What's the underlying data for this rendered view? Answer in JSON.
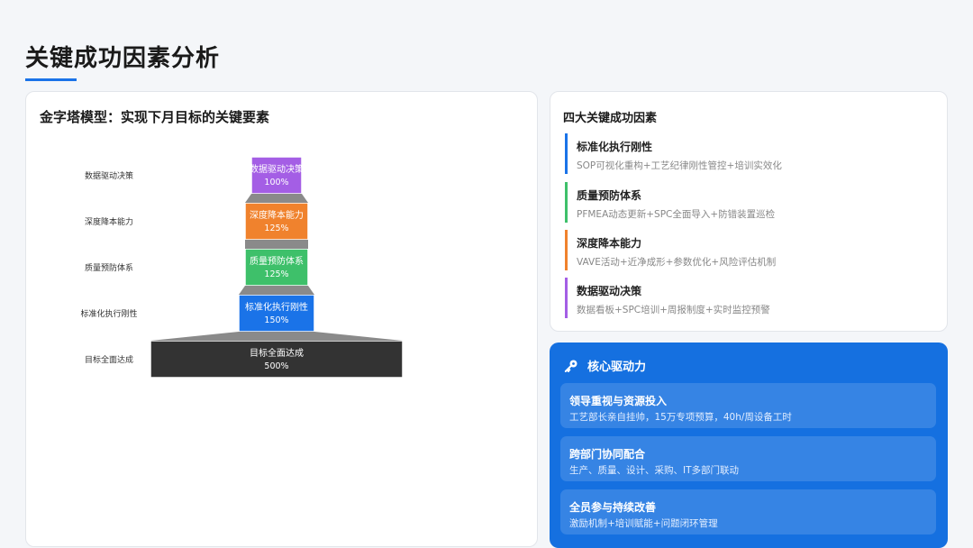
{
  "page": {
    "title": "关键成功因素分析"
  },
  "left_card": {
    "title": "金字塔模型：实现下月目标的关键要素"
  },
  "chart_data": {
    "type": "bar",
    "title": "金字塔模型：实现下月目标的关键要素",
    "categories": [
      "数据驱动决策",
      "深度降本能力",
      "质量预防体系",
      "标准化执行刚性",
      "目标全面达成"
    ],
    "series": [
      {
        "values": [
          100,
          125,
          125,
          150,
          500
        ]
      }
    ],
    "bar_labels": [
      "100%",
      "125%",
      "125%",
      "150%",
      "500%"
    ],
    "colors": [
      "#a45ee5",
      "#f0822d",
      "#3ec06a",
      "#1a73e8",
      "#333333"
    ],
    "orientation": "horizontal-centered-funnel",
    "connector_color": "#8a8a8a"
  },
  "factors_card": {
    "title": "四大关键成功因素",
    "items": [
      {
        "name": "标准化执行刚性",
        "desc": "SOP可视化重构+工艺纪律刚性管控+培训实效化",
        "color": "#1a73e8"
      },
      {
        "name": "质量预防体系",
        "desc": "PFMEA动态更新+SPC全面导入+防错装置巡检",
        "color": "#3ec06a"
      },
      {
        "name": "深度降本能力",
        "desc": "VAVE活动+近净成形+参数优化+风险评估机制",
        "color": "#f0822d"
      },
      {
        "name": "数据驱动决策",
        "desc": "数据看板+SPC培训+周报制度+实时监控预警",
        "color": "#a45ee5"
      }
    ]
  },
  "driver_card": {
    "title": "核心驱动力",
    "icon": "key-icon",
    "items": [
      {
        "title": "领导重视与资源投入",
        "desc": "工艺部长亲自挂帅，15万专项预算，40h/周设备工时"
      },
      {
        "title": "跨部门协同配合",
        "desc": "生产、质量、设计、采购、IT多部门联动"
      },
      {
        "title": "全员参与持续改善",
        "desc": "激励机制+培训赋能+问题闭环管理"
      }
    ]
  }
}
